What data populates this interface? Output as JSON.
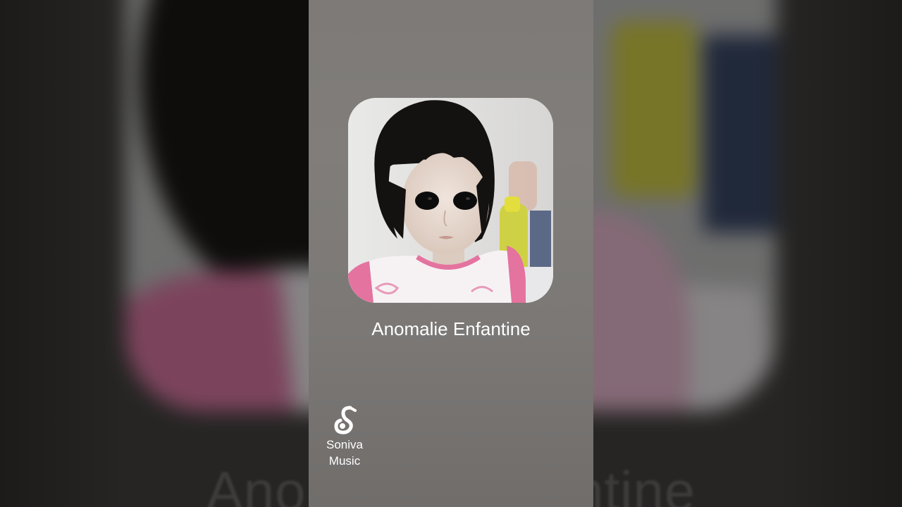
{
  "album": {
    "title": "Anomalie Enfantine",
    "cover_icon": "album-cover-portrait"
  },
  "branding": {
    "line1": "Soniva",
    "line2": "Music",
    "icon": "music-note-logo"
  },
  "colors": {
    "panel": "#7d7a77",
    "text": "#ffffff",
    "shirt_pink": "#e4739f"
  }
}
